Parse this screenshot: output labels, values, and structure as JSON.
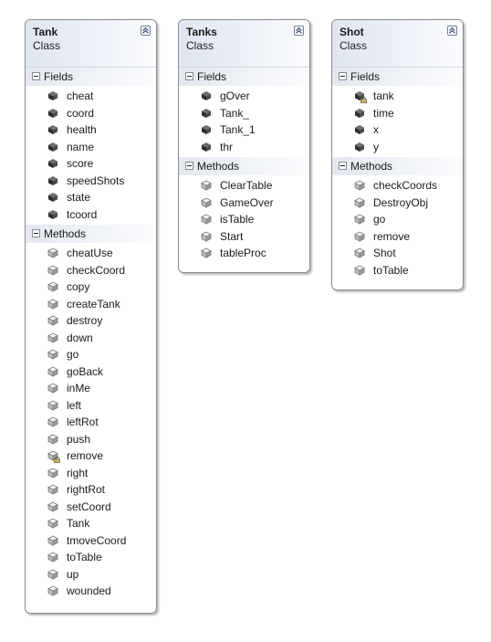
{
  "classes": [
    {
      "name": "Tank",
      "type": "Class",
      "fields_label": "Fields",
      "methods_label": "Methods",
      "fields": [
        "cheat",
        "coord",
        "health",
        "name",
        "score",
        "speedShots",
        "state",
        "tcoord"
      ],
      "methods": [
        "cheatUse",
        "checkCoord",
        "copy",
        "createTank",
        "destroy",
        "down",
        "go",
        "goBack",
        "inMe",
        "left",
        "leftRot",
        "push",
        "remove",
        "right",
        "rightRot",
        "setCoord",
        "Tank",
        "tmoveCoord",
        "toTable",
        "up",
        "wounded"
      ],
      "private_fields": [],
      "private_methods": [
        "remove"
      ]
    },
    {
      "name": "Tanks",
      "type": "Class",
      "fields_label": "Fields",
      "methods_label": "Methods",
      "fields": [
        "gOver",
        "Tank_",
        "Tank_1",
        "thr"
      ],
      "methods": [
        "ClearTable",
        "GameOver",
        "isTable",
        "Start",
        "tableProc"
      ],
      "private_fields": [],
      "private_methods": []
    },
    {
      "name": "Shot",
      "type": "Class",
      "fields_label": "Fields",
      "methods_label": "Methods",
      "fields": [
        "tank",
        "time",
        "x",
        "y"
      ],
      "methods": [
        "checkCoords",
        "DestroyObj",
        "go",
        "remove",
        "Shot",
        "toTable"
      ],
      "private_fields": [
        "tank"
      ],
      "private_methods": []
    }
  ],
  "icons": {
    "field": "field-icon",
    "method": "method-icon",
    "collapse": "collapse-chevron-icon",
    "section_toggle": "minus-toggle-icon",
    "private_overlay": "lock-overlay-icon"
  },
  "colors": {
    "header_gradient_start": "#dfe6f1",
    "border": "#8a8a8a",
    "field_icon": "#3c3c3c",
    "method_icon": "#8c8c8c"
  }
}
